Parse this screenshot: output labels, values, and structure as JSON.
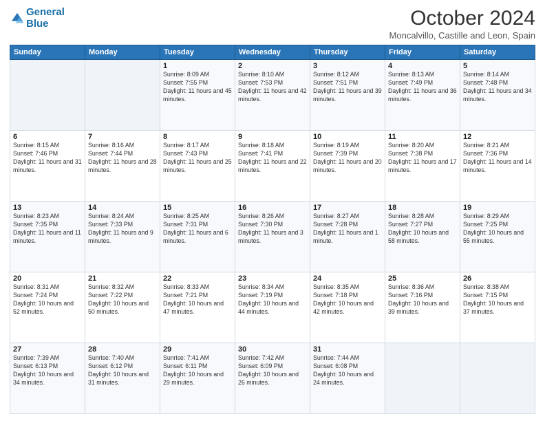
{
  "header": {
    "logo_line1": "General",
    "logo_line2": "Blue",
    "title": "October 2024",
    "subtitle": "Moncalvillo, Castille and Leon, Spain"
  },
  "weekdays": [
    "Sunday",
    "Monday",
    "Tuesday",
    "Wednesday",
    "Thursday",
    "Friday",
    "Saturday"
  ],
  "weeks": [
    [
      {
        "day": "",
        "info": ""
      },
      {
        "day": "",
        "info": ""
      },
      {
        "day": "1",
        "info": "Sunrise: 8:09 AM\nSunset: 7:55 PM\nDaylight: 11 hours and 45 minutes."
      },
      {
        "day": "2",
        "info": "Sunrise: 8:10 AM\nSunset: 7:53 PM\nDaylight: 11 hours and 42 minutes."
      },
      {
        "day": "3",
        "info": "Sunrise: 8:12 AM\nSunset: 7:51 PM\nDaylight: 11 hours and 39 minutes."
      },
      {
        "day": "4",
        "info": "Sunrise: 8:13 AM\nSunset: 7:49 PM\nDaylight: 11 hours and 36 minutes."
      },
      {
        "day": "5",
        "info": "Sunrise: 8:14 AM\nSunset: 7:48 PM\nDaylight: 11 hours and 34 minutes."
      }
    ],
    [
      {
        "day": "6",
        "info": "Sunrise: 8:15 AM\nSunset: 7:46 PM\nDaylight: 11 hours and 31 minutes."
      },
      {
        "day": "7",
        "info": "Sunrise: 8:16 AM\nSunset: 7:44 PM\nDaylight: 11 hours and 28 minutes."
      },
      {
        "day": "8",
        "info": "Sunrise: 8:17 AM\nSunset: 7:43 PM\nDaylight: 11 hours and 25 minutes."
      },
      {
        "day": "9",
        "info": "Sunrise: 8:18 AM\nSunset: 7:41 PM\nDaylight: 11 hours and 22 minutes."
      },
      {
        "day": "10",
        "info": "Sunrise: 8:19 AM\nSunset: 7:39 PM\nDaylight: 11 hours and 20 minutes."
      },
      {
        "day": "11",
        "info": "Sunrise: 8:20 AM\nSunset: 7:38 PM\nDaylight: 11 hours and 17 minutes."
      },
      {
        "day": "12",
        "info": "Sunrise: 8:21 AM\nSunset: 7:36 PM\nDaylight: 11 hours and 14 minutes."
      }
    ],
    [
      {
        "day": "13",
        "info": "Sunrise: 8:23 AM\nSunset: 7:35 PM\nDaylight: 11 hours and 11 minutes."
      },
      {
        "day": "14",
        "info": "Sunrise: 8:24 AM\nSunset: 7:33 PM\nDaylight: 11 hours and 9 minutes."
      },
      {
        "day": "15",
        "info": "Sunrise: 8:25 AM\nSunset: 7:31 PM\nDaylight: 11 hours and 6 minutes."
      },
      {
        "day": "16",
        "info": "Sunrise: 8:26 AM\nSunset: 7:30 PM\nDaylight: 11 hours and 3 minutes."
      },
      {
        "day": "17",
        "info": "Sunrise: 8:27 AM\nSunset: 7:28 PM\nDaylight: 11 hours and 1 minute."
      },
      {
        "day": "18",
        "info": "Sunrise: 8:28 AM\nSunset: 7:27 PM\nDaylight: 10 hours and 58 minutes."
      },
      {
        "day": "19",
        "info": "Sunrise: 8:29 AM\nSunset: 7:25 PM\nDaylight: 10 hours and 55 minutes."
      }
    ],
    [
      {
        "day": "20",
        "info": "Sunrise: 8:31 AM\nSunset: 7:24 PM\nDaylight: 10 hours and 52 minutes."
      },
      {
        "day": "21",
        "info": "Sunrise: 8:32 AM\nSunset: 7:22 PM\nDaylight: 10 hours and 50 minutes."
      },
      {
        "day": "22",
        "info": "Sunrise: 8:33 AM\nSunset: 7:21 PM\nDaylight: 10 hours and 47 minutes."
      },
      {
        "day": "23",
        "info": "Sunrise: 8:34 AM\nSunset: 7:19 PM\nDaylight: 10 hours and 44 minutes."
      },
      {
        "day": "24",
        "info": "Sunrise: 8:35 AM\nSunset: 7:18 PM\nDaylight: 10 hours and 42 minutes."
      },
      {
        "day": "25",
        "info": "Sunrise: 8:36 AM\nSunset: 7:16 PM\nDaylight: 10 hours and 39 minutes."
      },
      {
        "day": "26",
        "info": "Sunrise: 8:38 AM\nSunset: 7:15 PM\nDaylight: 10 hours and 37 minutes."
      }
    ],
    [
      {
        "day": "27",
        "info": "Sunrise: 7:39 AM\nSunset: 6:13 PM\nDaylight: 10 hours and 34 minutes."
      },
      {
        "day": "28",
        "info": "Sunrise: 7:40 AM\nSunset: 6:12 PM\nDaylight: 10 hours and 31 minutes."
      },
      {
        "day": "29",
        "info": "Sunrise: 7:41 AM\nSunset: 6:11 PM\nDaylight: 10 hours and 29 minutes."
      },
      {
        "day": "30",
        "info": "Sunrise: 7:42 AM\nSunset: 6:09 PM\nDaylight: 10 hours and 26 minutes."
      },
      {
        "day": "31",
        "info": "Sunrise: 7:44 AM\nSunset: 6:08 PM\nDaylight: 10 hours and 24 minutes."
      },
      {
        "day": "",
        "info": ""
      },
      {
        "day": "",
        "info": ""
      }
    ]
  ]
}
